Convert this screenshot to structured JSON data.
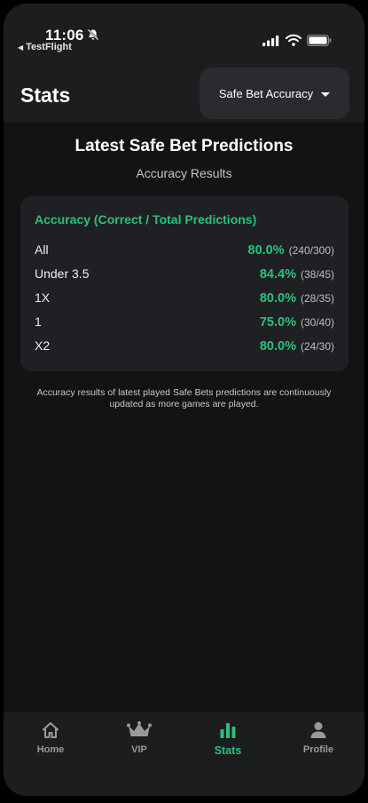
{
  "status_bar": {
    "time": "11:06",
    "back_app": "TestFlight"
  },
  "header": {
    "title": "Stats",
    "dropdown_selected": "Safe Bet Accuracy"
  },
  "main": {
    "heading": "Latest Safe Bet Predictions",
    "subheading": "Accuracy Results",
    "card": {
      "title": "Accuracy (Correct / Total Predictions)",
      "rows": [
        {
          "label": "All",
          "percent": "80.0%",
          "fraction": "(240/300)"
        },
        {
          "label": "Under 3.5",
          "percent": "84.4%",
          "fraction": "(38/45)"
        },
        {
          "label": "1X",
          "percent": "80.0%",
          "fraction": "(28/35)"
        },
        {
          "label": "1",
          "percent": "75.0%",
          "fraction": "(30/40)"
        },
        {
          "label": "X2",
          "percent": "80.0%",
          "fraction": "(24/30)"
        }
      ]
    },
    "footnote": "Accuracy results of latest played Safe Bets predictions are continuously updated as more games are played."
  },
  "tabbar": {
    "tabs": [
      {
        "label": "Home",
        "icon": "home-icon"
      },
      {
        "label": "VIP",
        "icon": "crown-icon"
      },
      {
        "label": "Stats",
        "icon": "bar-chart-icon",
        "active": true
      },
      {
        "label": "Profile",
        "icon": "person-icon"
      }
    ]
  },
  "colors": {
    "accent": "#2bc07b",
    "background": "#131313",
    "card": "#1f2023",
    "bar": "#1c1d1f"
  }
}
